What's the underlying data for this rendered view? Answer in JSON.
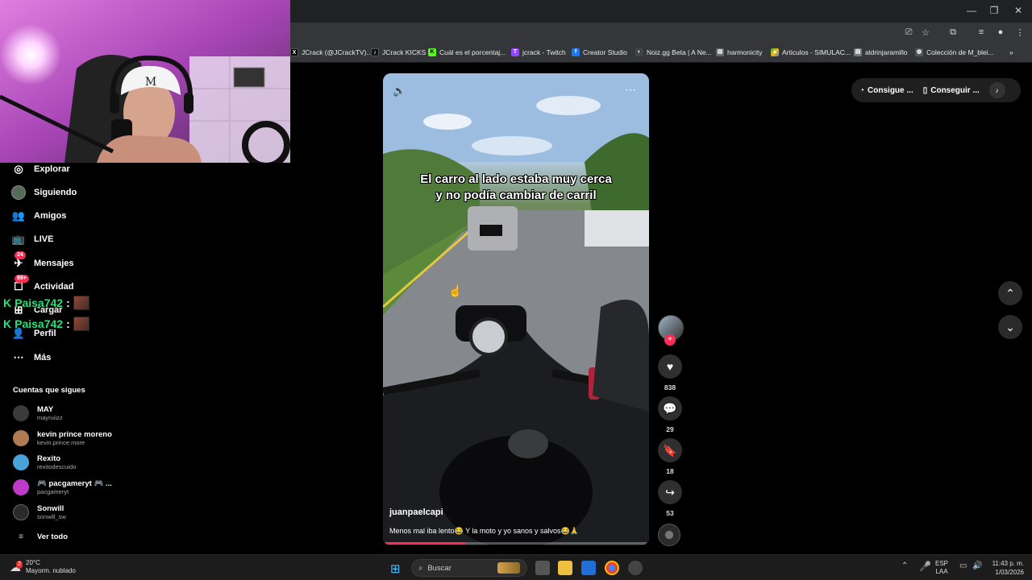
{
  "browser": {
    "bookmarks": [
      {
        "label": "JCrack (@JCrackTV)...",
        "icon": "x-icon",
        "color": "#000000"
      },
      {
        "label": "JCrack KICKS",
        "icon": "tiktok-icon",
        "color": "#111111"
      },
      {
        "label": "Cuál es el porcentaj...",
        "icon": "kick-icon",
        "color": "#53fc18"
      },
      {
        "label": "jcrack - Twitch",
        "icon": "twitch-icon",
        "color": "#9146ff"
      },
      {
        "label": "Creator Studio",
        "icon": "facebook-icon",
        "color": "#1877f2"
      },
      {
        "label": "Noiz.gg Beta | A Ne...",
        "icon": "noiz-icon",
        "color": "#444444"
      },
      {
        "label": "harmonicity",
        "icon": "page-icon",
        "color": "#666666"
      },
      {
        "label": "Articulos - SIMULAC...",
        "icon": "drive-icon",
        "color": "#34a853"
      },
      {
        "label": "aldrinjaramillo",
        "icon": "page-icon",
        "color": "#777777"
      },
      {
        "label": "Colección de M_blei...",
        "icon": "globe-icon",
        "color": "#555555"
      }
    ],
    "overflow": "»"
  },
  "sidebar": {
    "nav": [
      {
        "label": "Explorar",
        "icon": "compass-icon"
      },
      {
        "label": "Siguiendo",
        "icon": "following-avatar-icon"
      },
      {
        "label": "Amigos",
        "icon": "friends-icon"
      },
      {
        "label": "LIVE",
        "icon": "live-tv-icon"
      },
      {
        "label": "Mensajes",
        "icon": "messages-icon",
        "badge": "24"
      },
      {
        "label": "Actividad",
        "icon": "activity-icon",
        "badge": "99+"
      },
      {
        "label": "Cargar",
        "icon": "upload-icon"
      },
      {
        "label": "Perfil",
        "icon": "profile-icon"
      },
      {
        "label": "Más",
        "icon": "more-icon"
      }
    ],
    "chat_overlay": [
      {
        "user": "Paisa742",
        "sep": ":"
      },
      {
        "user": "Paisa742",
        "sep": ":"
      }
    ],
    "following_title": "Cuentas que sigues",
    "accounts": [
      {
        "name": "MAY",
        "user": "mayruiizz",
        "color": "#3a3a3a"
      },
      {
        "name": "kevin prince moreno",
        "user": "kevin.prince.more",
        "color": "#b07a55"
      },
      {
        "name": "Rexito",
        "user": "rexitodescuido",
        "color": "#4aa3d8"
      },
      {
        "name": "🎮 pacgameryt 🎮 ...",
        "user": "pacgameryt",
        "color": "#c03ac8"
      },
      {
        "name": "Sonwill",
        "user": "sonwill_sw",
        "color": "#2a2a2a"
      }
    ],
    "see_all": "Ver todo"
  },
  "video": {
    "caption_line1": "El carro al lado estaba muy cerca",
    "caption_line2": "y no podía cambiar de carril",
    "author": "juanpaelcapi",
    "description": "Menos mal iba lento😂 Y la moto y yo sanos y salvos😂🙏",
    "progress": 0.31,
    "actions": {
      "likes": "838",
      "comments": "29",
      "saves": "18",
      "shares": "53"
    }
  },
  "topbar": {
    "coins_label": "Consigue ...",
    "app_label": "Conseguir ..."
  },
  "taskbar": {
    "temp": "20°C",
    "weather": "Mayorm. nublado",
    "weather_badge": "2",
    "search_placeholder": "Buscar",
    "lang1": "ESP",
    "lang2": "LAA",
    "time": "11:43 p. m.",
    "date": "1/03/2026"
  }
}
